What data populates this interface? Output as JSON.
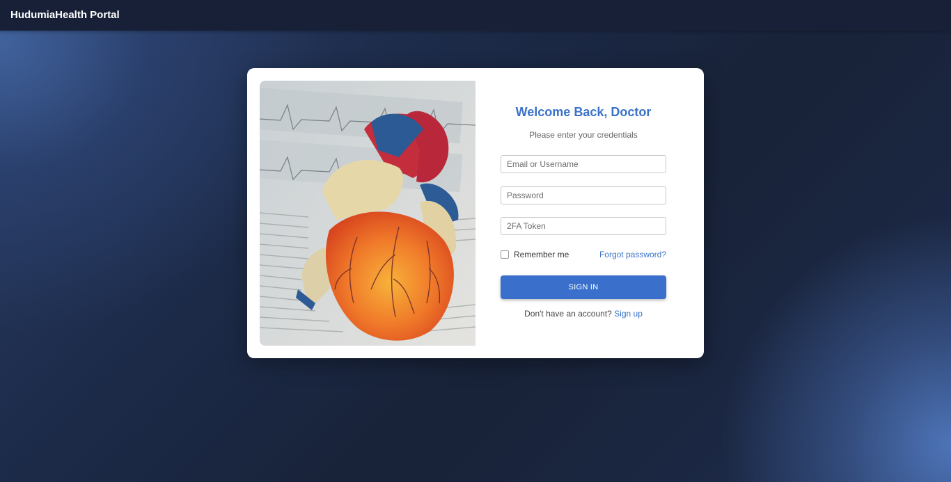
{
  "app": {
    "brand": "HudumiaHealth Portal"
  },
  "login": {
    "title": "Welcome Back, Doctor",
    "subtitle": "Please enter your credentials",
    "email_placeholder": "Email or Username",
    "password_placeholder": "Password",
    "token_placeholder": "2FA Token",
    "remember_label": "Remember me",
    "remember_checked": false,
    "forgot_label": "Forgot password?",
    "signin_label": "SIGN IN",
    "signup_prompt": "Don't have an account?",
    "signup_link": "Sign up"
  },
  "image": {
    "semantic": "anatomical-heart-model-photo"
  },
  "colors": {
    "accent": "#3a72c9",
    "navbar": "#172036",
    "background": "#1a2540"
  }
}
